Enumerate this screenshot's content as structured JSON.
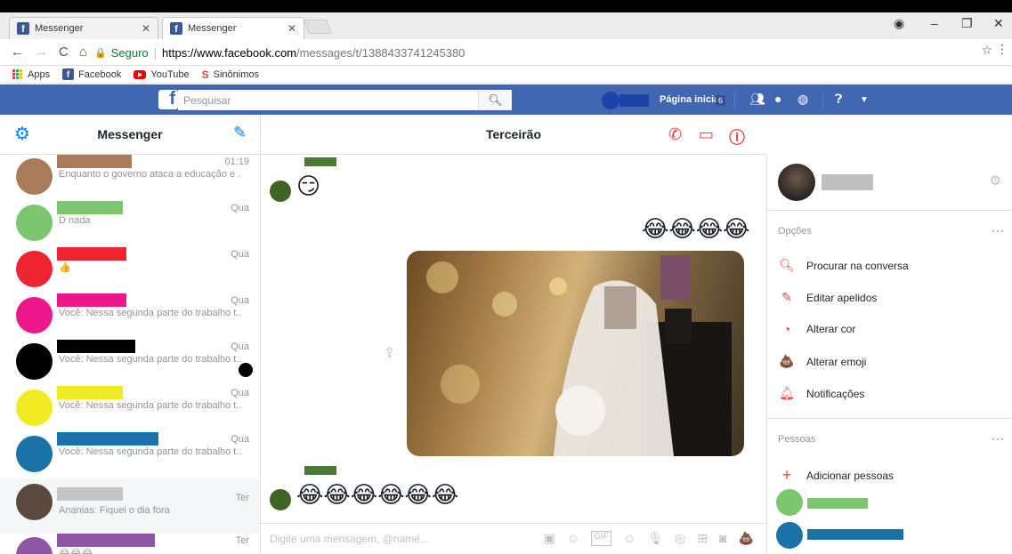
{
  "browser": {
    "tabs": [
      {
        "label": "Messenger",
        "active": false
      },
      {
        "label": "Messenger",
        "active": true
      }
    ],
    "url": {
      "secure_label": "Seguro",
      "host": "https://www.facebook.com",
      "path": "/messages/t/1388433741245380"
    },
    "bookmarks": [
      {
        "label": "Apps",
        "icon": "apps-grid-icon"
      },
      {
        "label": "Facebook",
        "icon": "facebook-icon"
      },
      {
        "label": "YouTube",
        "icon": "youtube-icon"
      },
      {
        "label": "Sinônimos",
        "icon": "sinonimos-s-icon"
      }
    ]
  },
  "fbbar": {
    "search_placeholder": "Pesquisar",
    "home_label": "Página inicial",
    "home_badge": "6",
    "color": "#4267b2"
  },
  "messenger": {
    "title": "Messenger",
    "conversations": [
      {
        "name_color": "#a87c5a",
        "avatar_color": "#a87c5a",
        "snippet": "Enquanto o governo ataca a educação e ...",
        "time": "01:19"
      },
      {
        "name_color": "#7dc66f",
        "avatar_color": "#7dc66f",
        "snippet": "D nada",
        "time": "Qua"
      },
      {
        "name_color": "#ee2430",
        "avatar_color": "#ee2430",
        "snippet": "👍",
        "time": "Qua"
      },
      {
        "name_color": "#ec1789",
        "avatar_color": "#ec1789",
        "snippet": "Você: Nessa segunda parte do trabalho t...",
        "time": "Qua"
      },
      {
        "name_color": "#000000",
        "avatar_color": "#000000",
        "snippet": "Você: Nessa segunda parte do trabalho t...",
        "time": "Qua"
      },
      {
        "name_color": "#f2ea22",
        "avatar_color": "#f2ea22",
        "snippet": "Você: Nessa segunda parte do trabalho t...",
        "time": "Qua"
      },
      {
        "name_color": "#1a72a6",
        "avatar_color": "#1a72a6",
        "snippet": "Você: Nessa segunda parte do trabalho t...",
        "time": "Qua"
      },
      {
        "name_color": "#c4c4c4",
        "avatar_color": "#5a4a40",
        "snippet": "Ananias: Fiquei o dia fora",
        "time": "Ter"
      },
      {
        "name_color": "#8e57a6",
        "avatar_color": "#8e57a6",
        "snippet": "😂😂😂",
        "time": "Ter"
      }
    ]
  },
  "chat": {
    "title": "Terceirão",
    "messages": [
      {
        "emoji": "😏"
      },
      {
        "emoji": "😂😂😂😂"
      },
      {
        "emoji": "😂😂😂😂😂😂"
      }
    ],
    "composer_placeholder": "Digite uma mensagem, @name...",
    "composer_icons": [
      "image-icon",
      "sticker-icon",
      "gif-icon",
      "emoji-icon",
      "mic-icon",
      "audio-icon",
      "game-icon",
      "camera-icon",
      "poop-emoji-icon"
    ]
  },
  "details": {
    "options_title": "Opções",
    "options": [
      {
        "label": "Procurar na conversa",
        "icon": "search-icon"
      },
      {
        "label": "Editar apelidos",
        "icon": "pencil-icon"
      },
      {
        "label": "Alterar cor",
        "icon": "palette-icon"
      },
      {
        "label": "Alterar emoji",
        "icon": "poop-emoji-icon"
      },
      {
        "label": "Notificações",
        "icon": "bell-icon"
      }
    ],
    "people_title": "Pessoas",
    "add_people_label": "Adicionar pessoas",
    "people": [
      {
        "color": "#7dc66f"
      },
      {
        "color": "#1a72a6"
      }
    ]
  },
  "colors": {
    "accent": "#0084ff",
    "chat_accent": "#fa3e3e"
  }
}
